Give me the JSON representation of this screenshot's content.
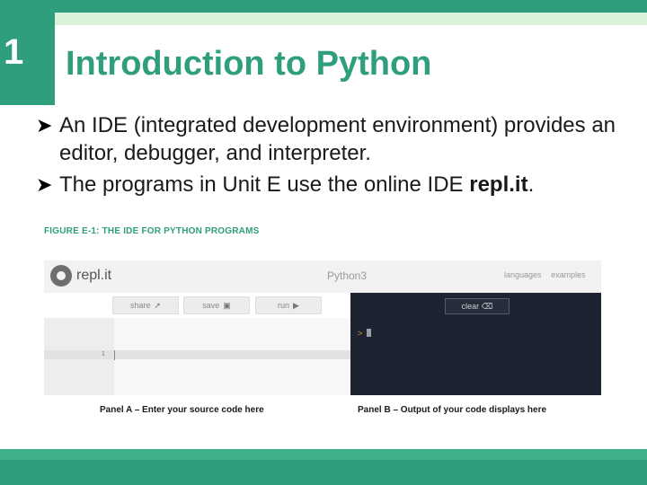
{
  "slide": {
    "number": "1",
    "title": "Introduction to Python",
    "bullets": [
      {
        "text": "An IDE (integrated development environment) provides an editor, debugger, and interpreter.",
        "bold": ""
      },
      {
        "text": "The programs in Unit E use the online IDE ",
        "bold": "repl.it",
        "suffix": "."
      }
    ],
    "bullet_icon": "arrow-bullet-icon"
  },
  "figure": {
    "caption": "FIGURE E-1: THE IDE FOR PYTHON PROGRAMS",
    "ide": {
      "brand": "repl.it",
      "language": "Python3",
      "links": [
        "languages",
        "examples"
      ],
      "buttons": [
        "share",
        "save",
        "run"
      ],
      "line_number": "1",
      "clear_label": "clear",
      "prompt": ">"
    },
    "panel_a_label": "Panel A – Enter your source code here",
    "panel_b_label": "Panel B – Output of your code displays here"
  },
  "colors": {
    "accent": "#2e9e7c",
    "accent_light": "#d9f2d9",
    "output_bg": "#1d2330"
  }
}
